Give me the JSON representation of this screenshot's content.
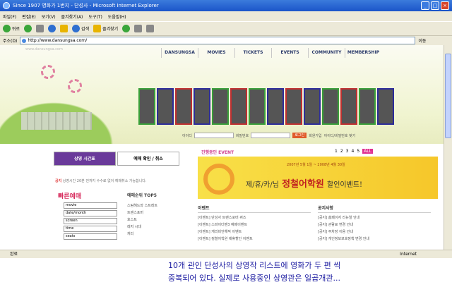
{
  "window": {
    "title": "Since 1907 영화가 1번지 - 단성사 - Microsoft Internet Explorer"
  },
  "menu": [
    "파일(F)",
    "편집(E)",
    "보기(V)",
    "즐겨찾기(A)",
    "도구(T)",
    "도움말(H)"
  ],
  "toolbar": {
    "back": "뒤로",
    "search": "검색",
    "favorites": "즐겨찾기"
  },
  "address": {
    "label": "주소(D)",
    "url": "http://www.dansungsa.com/",
    "go": "이동"
  },
  "site": {
    "logo": "www.dansungsa.com",
    "nav": [
      "DANSUNGSA",
      "MOVIES",
      "TICKETS",
      "EVENTS",
      "COMMUNITY",
      "MEMBERSHIP"
    ],
    "login": {
      "id_label": "아이디",
      "pw_label": "비밀번호",
      "btn": "로그인",
      "join": "회원가입",
      "find": "아이디/비밀번호 찾기"
    },
    "tabs": [
      "상영 시간표",
      "예매 확인 / 취소"
    ],
    "notice_label": "공지",
    "notice_text": "상영시간 20분 전까지 수수료 없이 예매취소 가능합니다.",
    "quick_title": "빠른예매",
    "top5_title": "예매순위 TOP5",
    "selects": [
      "movie",
      "date/month",
      "screen",
      "time",
      "seats"
    ],
    "top5": [
      "스팀헤드와 스트레트",
      "트랜스포머",
      "호스트",
      "레저 시대",
      "캐리"
    ],
    "event_label": "진행중인 EVENT",
    "pages": [
      "1",
      "2",
      "3",
      "4",
      "5"
    ],
    "all": "ALL",
    "banner_period": "2007년 5월 1일 ~ 2008년 4월 30일",
    "banner_main": "제/휴/카/님",
    "banner_title": "정철어학원",
    "banner_sub": "할인이벤트!",
    "events_title": "이벤트",
    "news_title": "공지사항",
    "events": [
      "[이벤트] 단성사 트랜스포머 퀴즈",
      "[이벤트] 스파이더맨3 예매이벤트",
      "[이벤트] 캐리비안해적 이벤트",
      "[이벤트] 정철어학원 제휴할인 이벤트"
    ],
    "news": [
      "[공지] 홈페이지 리뉴얼 안내",
      "[공지] 관람료 변경 안내",
      "[공지] 주차장 이용 안내",
      "[공지] 개인정보보호정책 변경 안내"
    ]
  },
  "status": {
    "text": "완료",
    "zone": "Internet"
  },
  "caption": [
    "10개 관인 단성사의 상영작 리스트에 영화가 두 편 씩",
    "중복되어 있다. 실제로 사용중인 상영관은 일곱개관..."
  ]
}
